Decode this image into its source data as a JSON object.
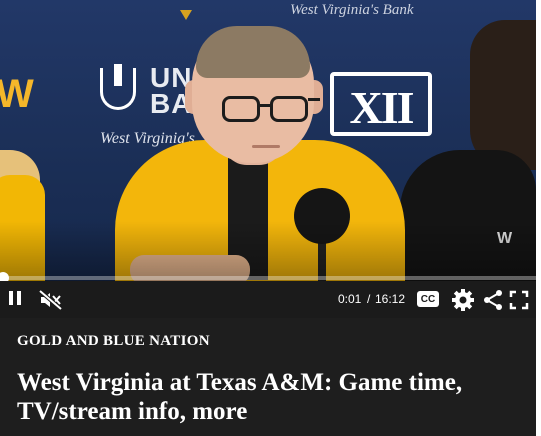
{
  "video": {
    "backdrop_text": {
      "top_banner": "West Virginia's Bank",
      "side_banner": "West Virginia's",
      "bank_name": "UNITED BANK",
      "conference_logo": "XII"
    },
    "player": {
      "current_time": "0:01",
      "separator": "/",
      "duration": "16:12",
      "progress_fraction": 0.001,
      "cc_label": "CC",
      "icons": [
        "pause-icon",
        "muted-speaker-icon",
        "closed-captions-icon",
        "gear-icon",
        "share-icon",
        "fullscreen-icon"
      ]
    }
  },
  "article": {
    "kicker": "GOLD AND BLUE NATION",
    "headline": "West Virginia at Texas A&M: Game time, TV/stream info, more"
  },
  "colors": {
    "player_bar": "#1b1b1b",
    "page_background": "#1e1e1e",
    "wvu_gold": "#f3b60b",
    "wall_navy": "#1c2f58"
  }
}
